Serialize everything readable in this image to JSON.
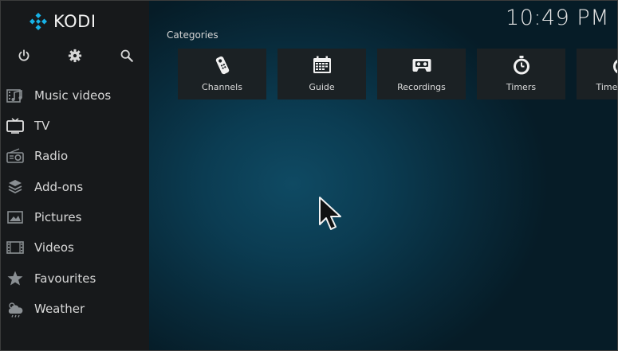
{
  "app": {
    "logo_text": "KODI",
    "accent": "#17b2e7"
  },
  "quick_actions": [
    {
      "icon": "power-icon"
    },
    {
      "icon": "gear-icon"
    },
    {
      "icon": "search-icon"
    }
  ],
  "menu": [
    {
      "label": "Music videos",
      "icon": "music-video-icon"
    },
    {
      "label": "TV",
      "icon": "tv-icon"
    },
    {
      "label": "Radio",
      "icon": "radio-icon"
    },
    {
      "label": "Add-ons",
      "icon": "addons-icon"
    },
    {
      "label": "Pictures",
      "icon": "pictures-icon"
    },
    {
      "label": "Videos",
      "icon": "film-icon"
    },
    {
      "label": "Favourites",
      "icon": "star-icon"
    },
    {
      "label": "Weather",
      "icon": "weather-icon"
    }
  ],
  "clock": "10:49 PM",
  "categories": {
    "title": "Categories",
    "items": [
      {
        "label": "Channels",
        "icon": "remote-icon"
      },
      {
        "label": "Guide",
        "icon": "calendar-icon"
      },
      {
        "label": "Recordings",
        "icon": "tape-icon"
      },
      {
        "label": "Timers",
        "icon": "stopwatch-icon"
      },
      {
        "label": "Timer rules",
        "icon": "stopwatch-icon"
      }
    ]
  }
}
